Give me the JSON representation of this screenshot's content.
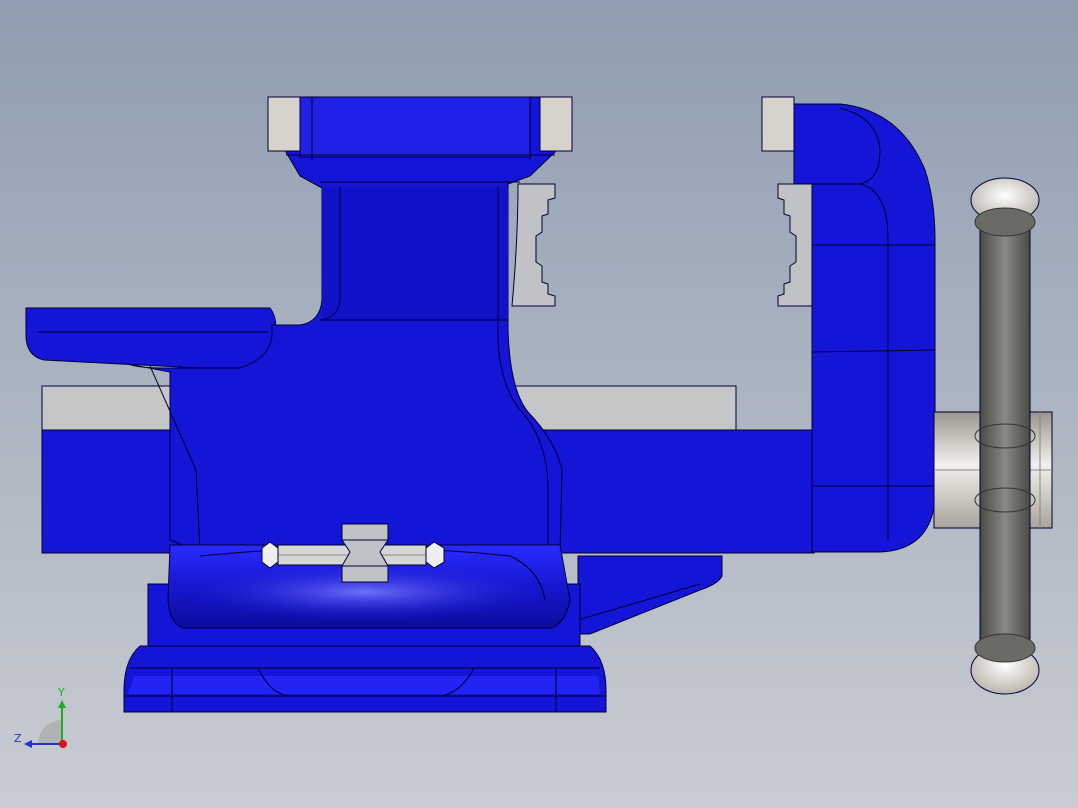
{
  "viewport": {
    "background_top": "#8f9db0",
    "background_bottom": "#c9ccd3"
  },
  "model": {
    "body_color": "#1515d8",
    "body_dark": "#0c0ca8",
    "body_light": "#3a3aff",
    "steel_color": "#c4c4c4",
    "jaw_insert_color": "#d8d2cc",
    "handle_color": "#6b6b66",
    "edge_color": "#000033"
  },
  "triad": {
    "y_label": "Y",
    "z_label": "Z",
    "y_color": "#22aa22",
    "z_color": "#2233cc",
    "x_dot_color": "#dd1111"
  }
}
